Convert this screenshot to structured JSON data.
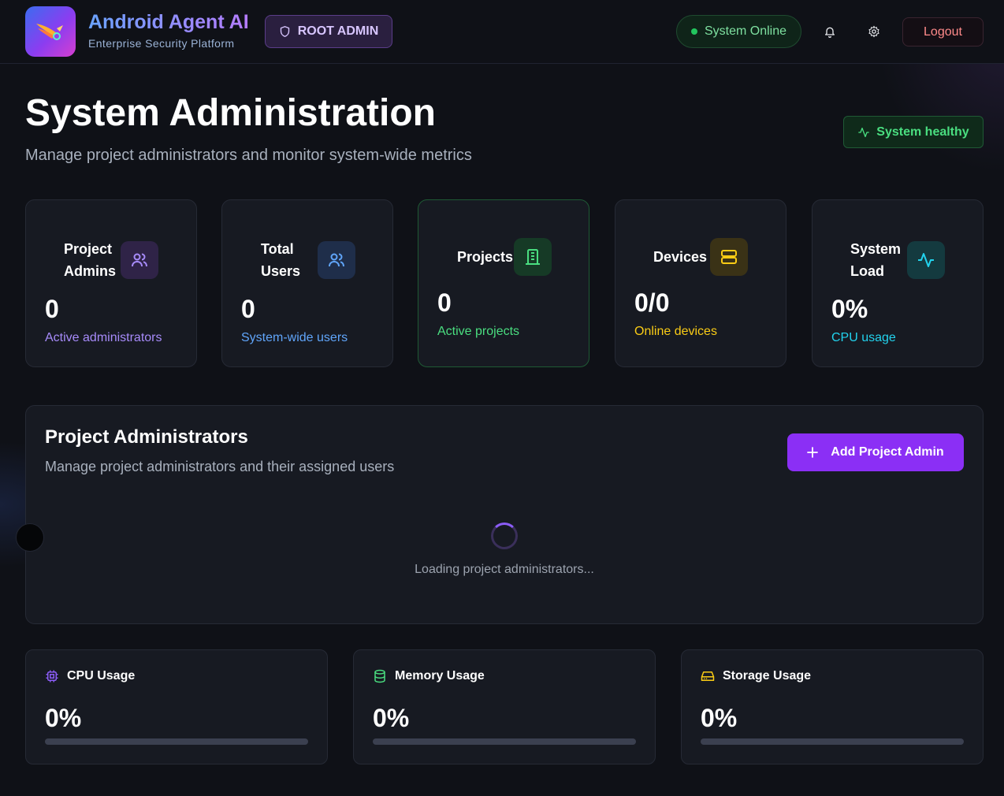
{
  "header": {
    "brand_title": "Android Agent AI",
    "brand_subtitle": "Enterprise Security Platform",
    "role_badge": "ROOT ADMIN",
    "status": "System Online",
    "logout_label": "Logout"
  },
  "page": {
    "title": "System Administration",
    "subtitle": "Manage project administrators and monitor system-wide metrics",
    "health_badge": "System healthy"
  },
  "stats": [
    {
      "label_line1": "Project",
      "label_line2": "Admins",
      "value": "0",
      "caption": "Active administrators",
      "accent": "#a78bfa",
      "icon": "users-icon"
    },
    {
      "label_line1": "Total",
      "label_line2": "Users",
      "value": "0",
      "caption": "System-wide users",
      "accent": "#60a5fa",
      "icon": "users-icon"
    },
    {
      "label_line1": "Projects",
      "value": "0",
      "caption": "Active projects",
      "accent": "#4ade80",
      "icon": "building-icon"
    },
    {
      "label_line1": "Devices",
      "value": "0/0",
      "caption": "Online devices",
      "accent": "#facc15",
      "icon": "server-icon"
    },
    {
      "label_line1": "System",
      "label_line2": "Load",
      "value": "0%",
      "caption": "CPU usage",
      "accent": "#22d3ee",
      "icon": "activity-icon"
    }
  ],
  "admins_panel": {
    "title": "Project Administrators",
    "subtitle": "Manage project administrators and their assigned users",
    "add_button": "Add Project Admin",
    "loading_text": "Loading project administrators..."
  },
  "usage": [
    {
      "label": "CPU Usage",
      "value": "0%",
      "percent": 0,
      "icon": "cpu-icon",
      "accent": "#8b5cf6"
    },
    {
      "label": "Memory Usage",
      "value": "0%",
      "percent": 0,
      "icon": "database-icon",
      "accent": "#4ade80"
    },
    {
      "label": "Storage Usage",
      "value": "0%",
      "percent": 0,
      "icon": "hard-drive-icon",
      "accent": "#facc15"
    }
  ]
}
